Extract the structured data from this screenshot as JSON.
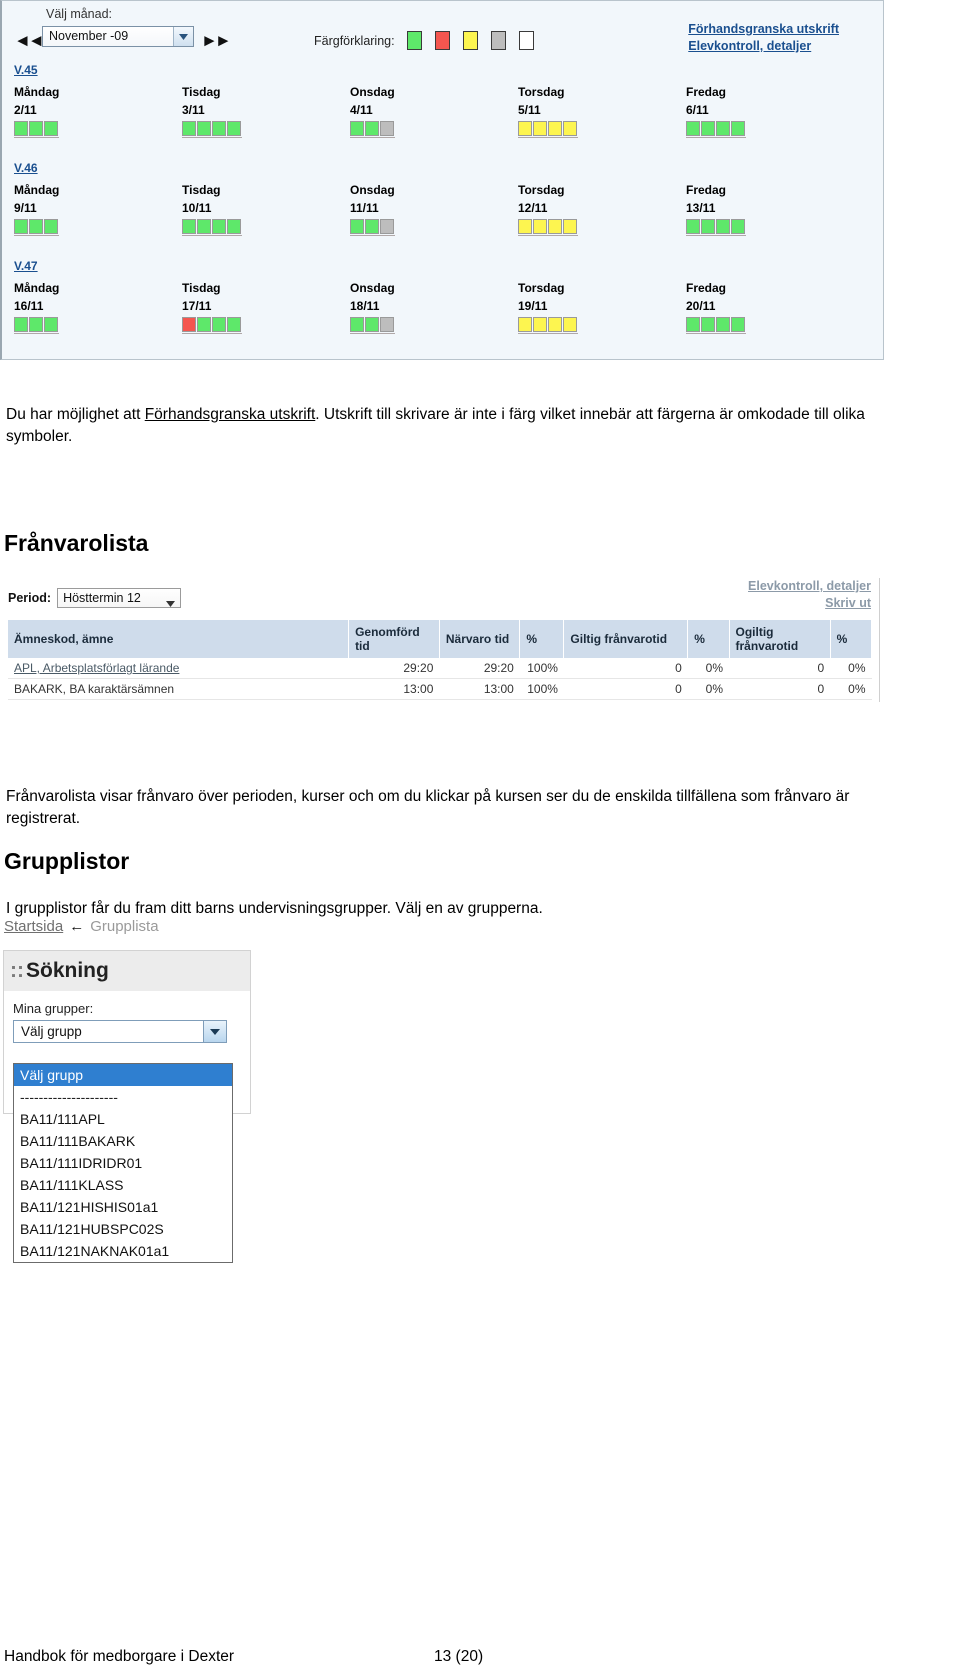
{
  "calendar": {
    "month_label": "Välj månad:",
    "selected_month": "November -09",
    "prev_icon": "double-arrow-left-icon",
    "next_icon": "double-arrow-right-icon",
    "legend_label": "Färgförklaring:",
    "legend_colors": [
      "#5ee86a",
      "#f4564f",
      "#fdf550",
      "#bdbdbd",
      "#ffffff"
    ],
    "links": {
      "preview": "Förhandsgranska utskrift",
      "details": "Elevkontroll, detaljer"
    },
    "weeks": [
      {
        "label": "V.45",
        "days": [
          {
            "name": "Måndag",
            "date": "2/11",
            "slots": [
              "green",
              "green",
              "green"
            ]
          },
          {
            "name": "Tisdag",
            "date": "3/11",
            "slots": [
              "green",
              "green",
              "green",
              "green"
            ]
          },
          {
            "name": "Onsdag",
            "date": "4/11",
            "slots": [
              "green",
              "green",
              "gray"
            ]
          },
          {
            "name": "Torsdag",
            "date": "5/11",
            "slots": [
              "yellow",
              "yellow",
              "yellow",
              "yellow"
            ]
          },
          {
            "name": "Fredag",
            "date": "6/11",
            "slots": [
              "green",
              "green",
              "green",
              "green"
            ]
          }
        ]
      },
      {
        "label": "V.46",
        "days": [
          {
            "name": "Måndag",
            "date": "9/11",
            "slots": [
              "green",
              "green",
              "green"
            ]
          },
          {
            "name": "Tisdag",
            "date": "10/11",
            "slots": [
              "green",
              "green",
              "green",
              "green"
            ]
          },
          {
            "name": "Onsdag",
            "date": "11/11",
            "slots": [
              "green",
              "green",
              "gray"
            ]
          },
          {
            "name": "Torsdag",
            "date": "12/11",
            "slots": [
              "yellow",
              "yellow",
              "yellow",
              "yellow"
            ]
          },
          {
            "name": "Fredag",
            "date": "13/11",
            "slots": [
              "green",
              "green",
              "green",
              "green"
            ]
          }
        ]
      },
      {
        "label": "V.47",
        "days": [
          {
            "name": "Måndag",
            "date": "16/11",
            "slots": [
              "green",
              "green",
              "green"
            ]
          },
          {
            "name": "Tisdag",
            "date": "17/11",
            "slots": [
              "red",
              "green",
              "green",
              "green"
            ]
          },
          {
            "name": "Onsdag",
            "date": "18/11",
            "slots": [
              "green",
              "green",
              "gray"
            ]
          },
          {
            "name": "Torsdag",
            "date": "19/11",
            "slots": [
              "yellow",
              "yellow",
              "yellow",
              "yellow"
            ]
          },
          {
            "name": "Fredag",
            "date": "20/11",
            "slots": [
              "green",
              "green",
              "green",
              "green"
            ]
          }
        ]
      }
    ]
  },
  "paragraphs": {
    "preview_intro_before": "Du har möjlighet att ",
    "preview_intro_link": "Förhandsgranska utskrift",
    "preview_intro_after": ". Utskrift till skrivare är inte i färg vilket innebär att färgerna är omkodade till olika symboler.",
    "franvaro_desc": "Frånvarolista visar frånvaro över perioden, kurser och om du klickar på kursen ser du de enskilda tillfällena som frånvaro är registrerat.",
    "grupp_desc": "I grupplistor får du fram ditt barns undervisningsgrupper. Välj en av grupperna."
  },
  "franvaro": {
    "heading": "Frånvarolista",
    "period_label": "Period:",
    "period_value": "Hösttermin 12",
    "links": {
      "details": "Elevkontroll, detaljer",
      "logout": "Skriv ut"
    },
    "columns": [
      "Ämneskod, ämne",
      "Genomförd tid",
      "Närvaro tid",
      "%",
      "Giltig frånvarotid",
      "%",
      "Ogiltig frånvarotid",
      "%"
    ],
    "rows": [
      {
        "subject": "APL, Arbetsplatsförlagt lärande",
        "genomford_tid": "29:20",
        "narvaro_tid": "29:20",
        "narvaro_pct": "100%",
        "giltig": "0",
        "giltig_pct": "0%",
        "ogiltig": "0",
        "ogiltig_pct": "0%"
      },
      {
        "subject": "BAKARK, BA karaktärsämnen",
        "genomford_tid": "13:00",
        "narvaro_tid": "13:00",
        "narvaro_pct": "100%",
        "giltig": "0",
        "giltig_pct": "0%",
        "ogiltig": "0",
        "ogiltig_pct": "0%"
      }
    ]
  },
  "grupplistor": {
    "heading": "Grupplistor",
    "breadcrumb": {
      "home": "Startsida",
      "arrow": "←",
      "current": "Grupplista"
    },
    "panel": {
      "colons": "::",
      "title": "Sökning",
      "field_label": "Mina grupper:",
      "selected_value": "Välj grupp",
      "options": [
        "Välj grupp",
        "---------------------",
        "BA11/111APL",
        "BA11/111BAKARK",
        "BA11/111IDRIDR01",
        "BA11/111KLASS",
        "BA11/121HISHIS01a1",
        "BA11/121HUBSPC02S",
        "BA11/121NAKNAK01a1"
      ]
    }
  },
  "footer": {
    "title": "Handbok för medborgare i Dexter",
    "page": "13 (20)"
  }
}
